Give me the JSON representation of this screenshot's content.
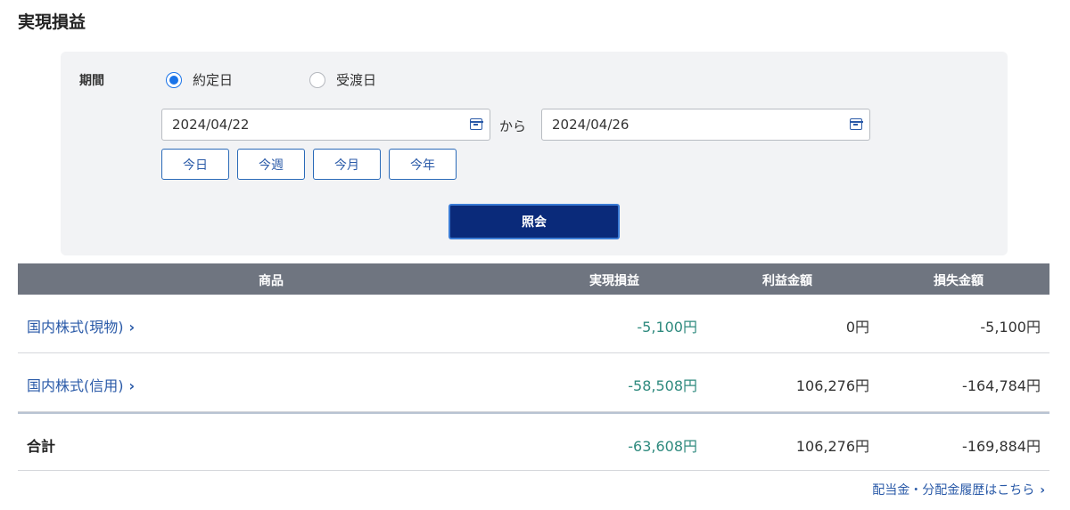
{
  "page": {
    "title": "実現損益"
  },
  "filter": {
    "period_label": "期間",
    "radio_options": [
      {
        "label": "約定日",
        "checked": true
      },
      {
        "label": "受渡日",
        "checked": false
      }
    ],
    "date_from": "2024/04/22",
    "separator": "から",
    "date_to": "2024/04/26",
    "quick_buttons": [
      "今日",
      "今週",
      "今月",
      "今年"
    ],
    "search_label": "照会"
  },
  "table": {
    "headers": {
      "product": "商品",
      "realized": "実現損益",
      "profit": "利益金額",
      "loss": "損失金額"
    },
    "rows": [
      {
        "name": "国内株式(現物)",
        "realized": "-5,100円",
        "profit": "0円",
        "loss": "-5,100円"
      },
      {
        "name": "国内株式(信用)",
        "realized": "-58,508円",
        "profit": "106,276円",
        "loss": "-164,784円"
      }
    ],
    "total": {
      "label": "合計",
      "realized": "-63,608円",
      "profit": "106,276円",
      "loss": "-169,884円"
    }
  },
  "footer": {
    "link_label": "配当金・分配金履歴はこちら"
  },
  "icons": {
    "chevron": "›"
  },
  "colors": {
    "link": "#2a5aa8",
    "negative_realized": "#2e8a7e",
    "primary_button": "#0a2a7a",
    "header_bg": "#6f7580",
    "panel_bg": "#f2f3f5"
  }
}
